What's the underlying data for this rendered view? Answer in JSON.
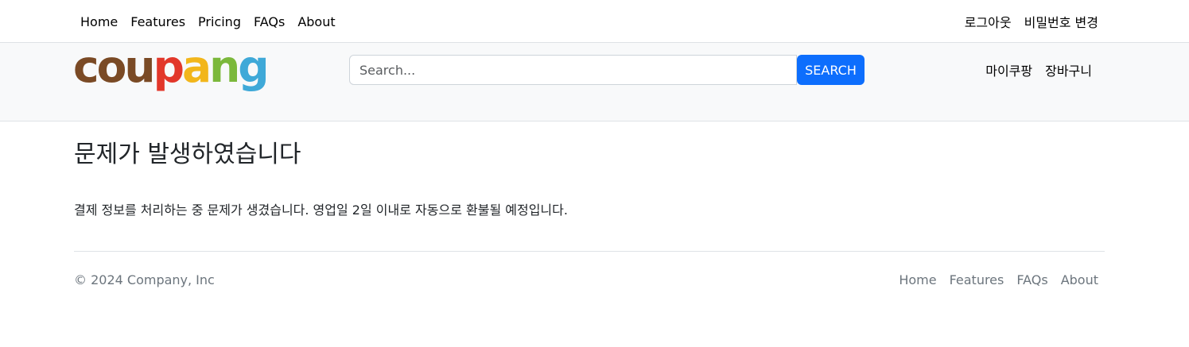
{
  "topnav": [
    "Home",
    "Features",
    "Pricing",
    "FAQs",
    "About"
  ],
  "account": {
    "logout": "로그아웃",
    "change_password": "비밀번호 변경"
  },
  "header": {
    "logo": [
      "c",
      "o",
      "u",
      "p",
      "a",
      "n",
      "g"
    ],
    "search_placeholder": "Search...",
    "search_button": "SEARCH",
    "links": [
      "마이쿠팡",
      "장바구니"
    ]
  },
  "main": {
    "title": "문제가 발생하였습니다",
    "message": "결제 정보를 처리하는 중 문제가 생겼습니다. 영업일 2일 이내로 자동으로 환불될 예정입니다."
  },
  "footer": {
    "copyright": "© 2024 Company, Inc",
    "nav": [
      "Home",
      "Features",
      "FAQs",
      "About"
    ]
  }
}
